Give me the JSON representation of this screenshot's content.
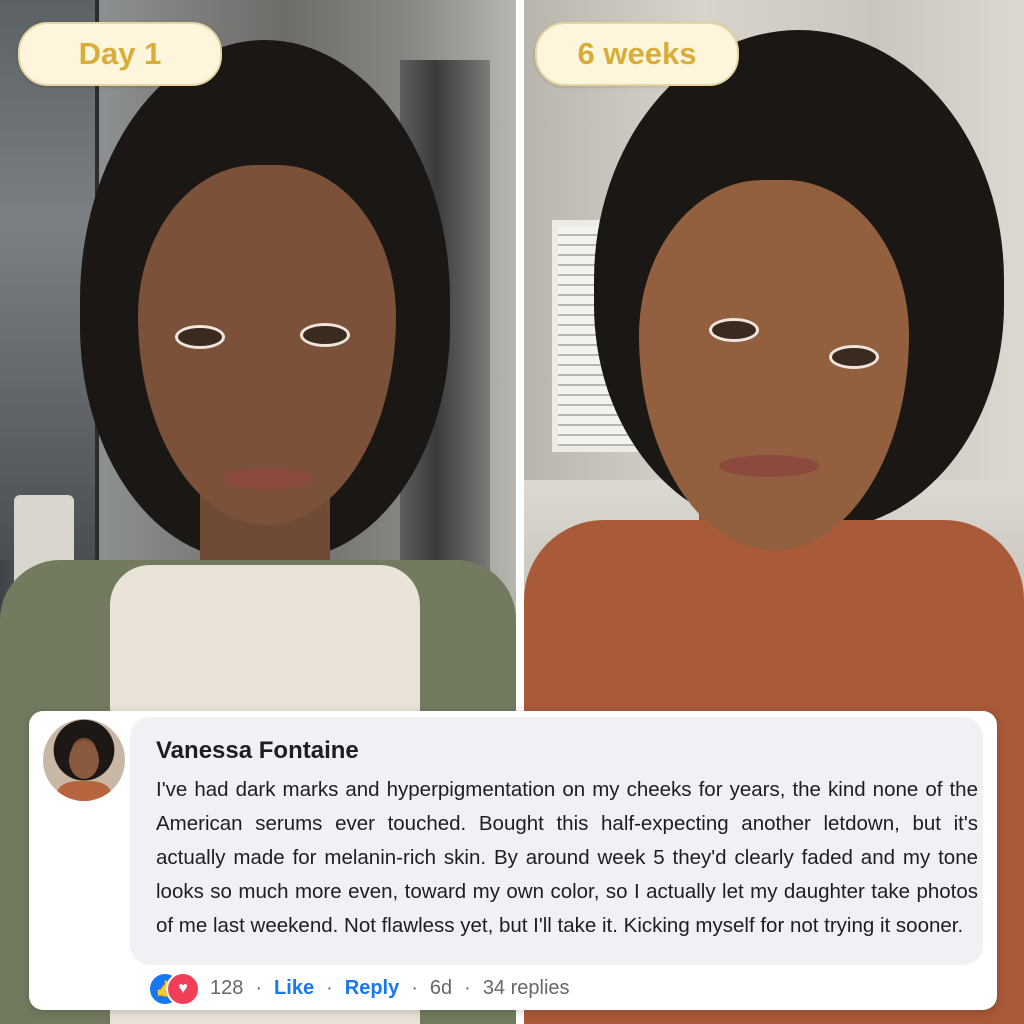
{
  "labels": {
    "before": "Day 1",
    "after": "6 weeks"
  },
  "comment": {
    "author": "Vanessa Fontaine",
    "text": "I've had dark marks and hyperpigmentation on my cheeks for years, the kind none of the American serums ever touched. Bought this half-expecting another letdown, but it's actually made for melanin-rich skin. By around week 5 they'd clearly faded and my tone looks so much more even, toward my own color, so I actually let my daughter take photos of me last weekend. Not flawless yet, but I'll take it. Kicking myself for not trying it sooner.",
    "reaction_count": "128",
    "like_label": "Like",
    "reply_label": "Reply",
    "age": "6d",
    "replies": "34 replies",
    "separator": "·"
  },
  "icons": {
    "like": "thumbs-up-icon",
    "love": "heart-icon"
  },
  "colors": {
    "label_text": "#d8ae38",
    "label_bg": "#fdf5dc",
    "link_blue": "#1877f2",
    "bubble_bg": "#f0f1f4"
  }
}
